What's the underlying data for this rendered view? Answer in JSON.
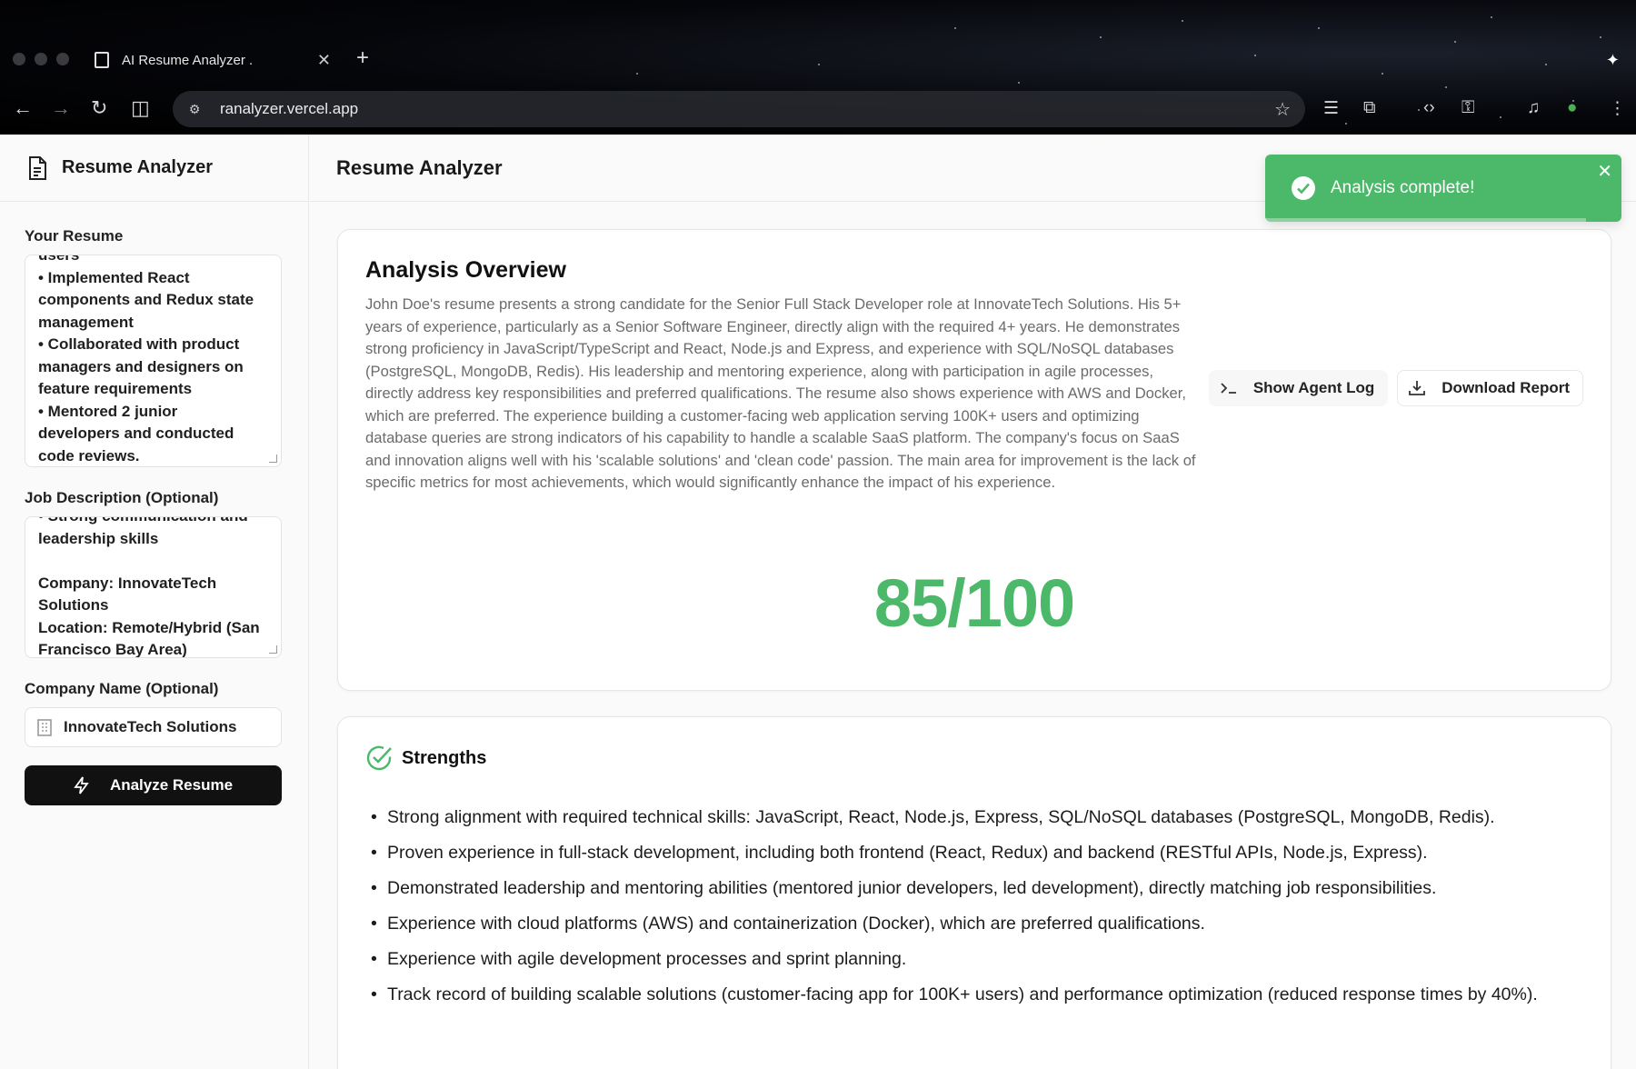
{
  "browser": {
    "tab_title": "AI Resume Analyzer .",
    "url": "ranalyzer.vercel.app"
  },
  "sidebar": {
    "title": "Resume Analyzer",
    "resume_label": "Your Resume",
    "resume_lines": [
      "users",
      "• Implemented React",
      "components and Redux state",
      "management",
      "• Collaborated with product",
      "managers and designers on",
      "feature requirements",
      "• Mentored 2 junior",
      "developers and conducted",
      "code reviews."
    ],
    "job_label": "Job Description (Optional)",
    "job_lines": [
      "• Strong communication and",
      "leadership skills",
      "",
      "Company: InnovateTech",
      "Solutions",
      "Location: Remote/Hybrid (San",
      "Francisco Bay Area)"
    ],
    "company_label": "Company Name (Optional)",
    "company_value": "InnovateTech Solutions",
    "analyze_label": "Analyze Resume"
  },
  "main": {
    "title": "Resume Analyzer",
    "overview": {
      "title": "Analysis Overview",
      "text": "John Doe's resume presents a strong candidate for the Senior Full Stack Developer role at InnovateTech Solutions. His 5+ years of experience, particularly as a Senior Software Engineer, directly align with the required 4+ years. He demonstrates strong proficiency in JavaScript/TypeScript and React, Node.js and Express, and experience with SQL/NoSQL databases (PostgreSQL, MongoDB, Redis). His leadership and mentoring experience, along with participation in agile processes, directly address key responsibilities and preferred qualifications. The resume also shows experience with AWS and Docker, which are preferred. The experience building a customer-facing web application serving 100K+ users and optimizing database queries are strong indicators of his capability to handle a scalable SaaS platform. The company's focus on SaaS and innovation aligns well with his 'scalable solutions' and 'clean code' passion. The main area for improvement is the lack of specific metrics for most achievements, which would significantly enhance the impact of his experience.",
      "show_log_label": "Show Agent Log",
      "download_label": "Download Report",
      "score": "85/100"
    },
    "strengths": {
      "title": "Strengths",
      "items": [
        "Strong alignment with required technical skills: JavaScript, React, Node.js, Express, SQL/NoSQL databases (PostgreSQL, MongoDB, Redis).",
        "Proven experience in full-stack development, including both frontend (React, Redux) and backend (RESTful APIs, Node.js, Express).",
        "Demonstrated leadership and mentoring abilities (mentored junior developers, led development), directly matching job responsibilities.",
        "Experience with cloud platforms (AWS) and containerization (Docker), which are preferred qualifications.",
        "Experience with agile development processes and sprint planning.",
        "Track record of building scalable solutions (customer-facing app for 100K+ users) and performance optimization (reduced response times by 40%)."
      ]
    }
  },
  "toast": {
    "message": "Analysis complete!"
  },
  "colors": {
    "accent_green": "#4cb86a",
    "button_dark": "#111111"
  }
}
